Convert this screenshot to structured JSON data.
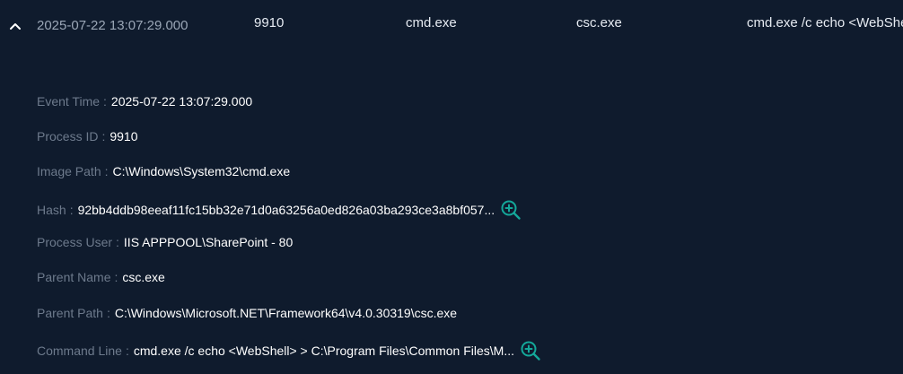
{
  "row": {
    "time": "2025-07-22 13:07:29.000",
    "pid": "9910",
    "process": "cmd.exe",
    "parent": "csc.exe",
    "command": "cmd.exe /c echo <WebShell> > C:\\Program Files\\Common Files\\M..."
  },
  "details": {
    "event_time": {
      "label": "Event Time",
      "sep": ":",
      "value": "2025-07-22 13:07:29.000"
    },
    "process_id": {
      "label": "Process ID",
      "sep": ":",
      "value": "9910"
    },
    "image_path": {
      "label": "Image Path",
      "sep": ":",
      "value": "C:\\Windows\\System32\\cmd.exe"
    },
    "hash": {
      "label": "Hash",
      "sep": ":",
      "value": "92bb4ddb98eeaf11fc15bb32e71d0a63256a0ed826a03ba293ce3a8bf057..."
    },
    "process_user": {
      "label": "Process User",
      "sep": ":",
      "value": "IIS APPPOOL\\SharePoint - 80"
    },
    "parent_name": {
      "label": "Parent Name",
      "sep": ":",
      "value": "csc.exe"
    },
    "parent_path": {
      "label": "Parent Path",
      "sep": ":",
      "value": "C:\\Windows\\Microsoft.NET\\Framework64\\v4.0.30319\\csc.exe"
    },
    "command_line": {
      "label": "Command Line",
      "sep": ":",
      "value": "cmd.exe /c echo <WebShell> > C:\\Program Files\\Common Files\\M..."
    }
  },
  "icons": {
    "collapse": "chevron-up-icon",
    "zoom": "zoom-in-icon"
  },
  "colors": {
    "background": "#0f1b2d",
    "accent": "#14a89a",
    "label": "#6d7a8c",
    "value": "#ffffff"
  }
}
